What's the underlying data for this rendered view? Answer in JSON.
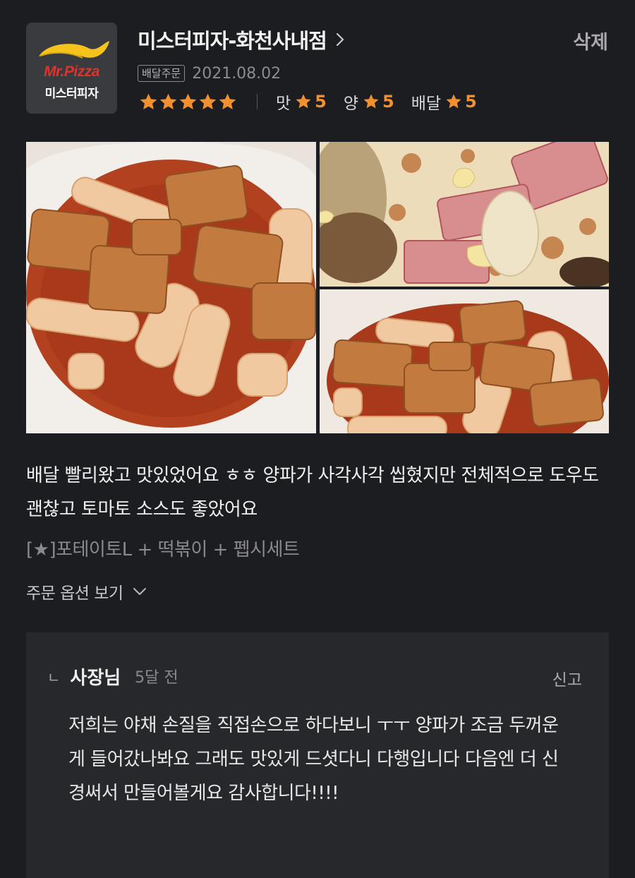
{
  "colors": {
    "background": "#1c1d21",
    "reply_background": "#27282c",
    "star": "#f29030",
    "brand_red": "#e2322b",
    "brand_yellow": "#f6c21c"
  },
  "store": {
    "logo_brand": "Mr.Pizza",
    "logo_brand_ko": "미스터피자",
    "name": "미스터피자-화천사내점",
    "chevron_icon": "chevron-right-icon",
    "delete_label": "삭제"
  },
  "order": {
    "type_badge": "배달주문",
    "date": "2021.08.02"
  },
  "rating": {
    "overall_stars": 5,
    "taste_label": "맛",
    "taste_value": "5",
    "amount_label": "양",
    "amount_value": "5",
    "delivery_label": "배달",
    "delivery_value": "5"
  },
  "photos": [
    {
      "subject": "tteokbokki"
    },
    {
      "subject": "pizza"
    },
    {
      "subject": "tteokbokki"
    }
  ],
  "review": {
    "text": "배달 빨리왔고 맛있었어요 ㅎㅎ 양파가 사각사각 씹혔지만 전체적으로 도우도 괜찮고 토마토 소스도 좋았어요",
    "menu": "[★]포테이토L + 떡볶이 + 펩시세트",
    "options_label": "주문 옵션 보기"
  },
  "reply": {
    "mark": "ㄴ",
    "owner": "사장님",
    "time": "5달 전",
    "report_label": "신고",
    "text": "저희는 야채 손질을 직접손으로 하다보니 ㅜㅜ 양파가 조금 두꺼운게 들어갔나봐요 그래도 맛있게 드셧다니 다행입니다 다음엔 더 신경써서 만들어볼게요 감사합니다!!!!"
  }
}
